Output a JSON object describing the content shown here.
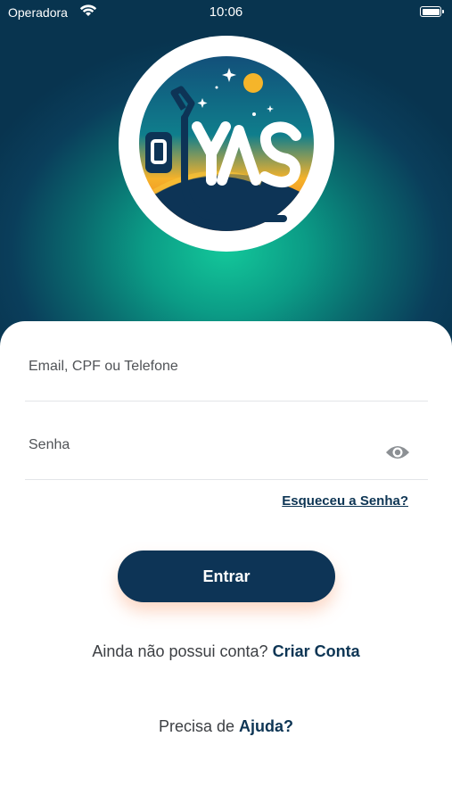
{
  "status_bar": {
    "carrier": "Operadora",
    "time": "10:06"
  },
  "logo": {
    "text": "YAS",
    "icon": "fuel-nozzle-logo-icon"
  },
  "login_form": {
    "email_label": "Email, CPF ou Telefone",
    "password_label": "Senha",
    "password_visibility_icon": "eye-icon",
    "forgot_password": "Esqueceu a Senha?",
    "submit_label": "Entrar"
  },
  "signup": {
    "prompt": "Ainda não possui conta?",
    "link": "Criar Conta"
  },
  "help": {
    "prompt": "Precisa de",
    "link": "Ajuda?"
  },
  "colors": {
    "primary": "#0d3456",
    "accent_orange": "#f59a2a",
    "gradient_teal": "#13c79a"
  }
}
